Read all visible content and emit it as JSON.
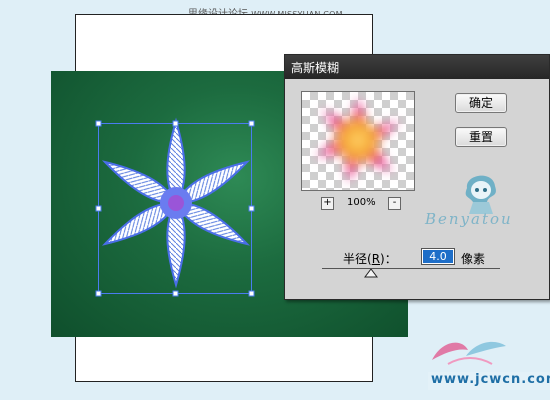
{
  "watermark": {
    "site_cn": "思缘设计论坛",
    "site_url": "WWW.MISSYUAN.COM"
  },
  "dialog": {
    "title": "高斯模糊",
    "ok_label": "确定",
    "reset_label": "重置",
    "zoom_in": "+",
    "zoom_out": "-",
    "zoom_level": "100%",
    "radius_label_prefix": "半径(",
    "radius_label_hotkey": "R",
    "radius_label_suffix": ")：",
    "radius_value": "4.0",
    "radius_unit": "像素"
  },
  "signature": "Benyatou",
  "site_mark": "www.jcwcn.com",
  "colors": {
    "canvas_bg": "#dfeff7",
    "green_fill": "#1c6b3f",
    "selection": "#4a7cf0",
    "dialog_bg": "#d4d4d4",
    "title_bar": "#2f2f2f",
    "input_highlight": "#1e6ec8",
    "preview_pink": "#e8509a",
    "preview_orange": "#f5a531"
  },
  "icons": {
    "flower": "flower-icon",
    "mascot": "mascot-icon",
    "slider": "slider-thumb-icon",
    "logo": "bird-logo-icon"
  }
}
